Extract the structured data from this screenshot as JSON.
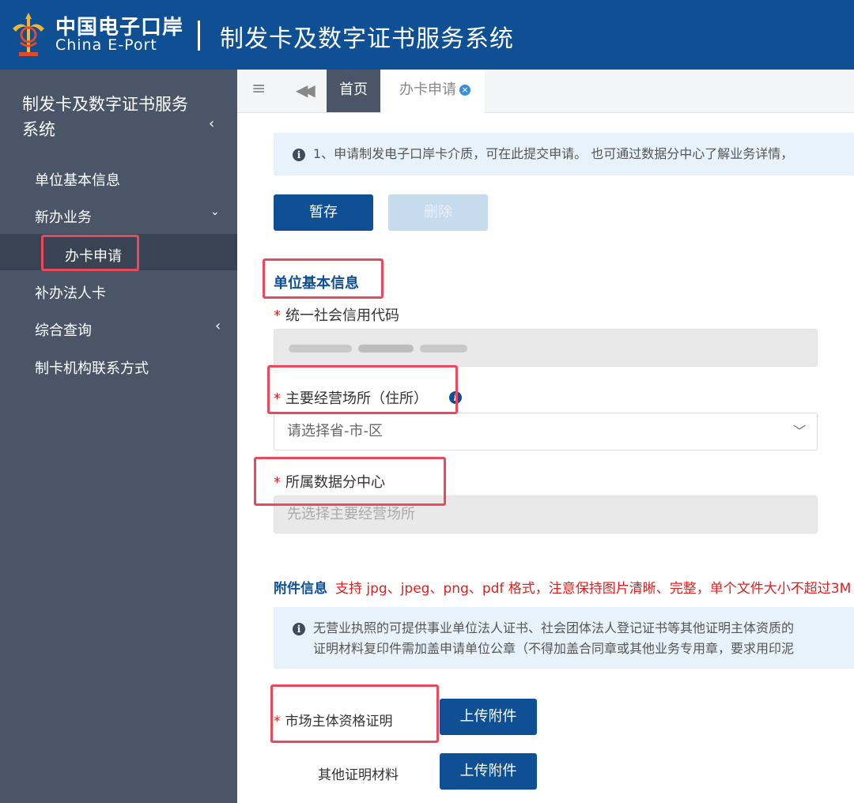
{
  "header": {
    "logo_cn": "中国电子口岸",
    "logo_en": "China E-Port",
    "system_title": "制发卡及数字证书服务系统"
  },
  "sidebar": {
    "title": "制发卡及数字证书服务系统",
    "items": [
      {
        "label": "单位基本信息"
      },
      {
        "label": "新办业务",
        "expanded": true,
        "children": [
          {
            "label": "办卡申请",
            "active": true
          }
        ]
      },
      {
        "label": "补办法人卡"
      },
      {
        "label": "综合查询"
      },
      {
        "label": "制卡机构联系方式"
      }
    ],
    "icons": {
      "collapse": "chevron-left-icon",
      "expand": "chevron-down-icon"
    }
  },
  "tabs": {
    "icons": {
      "menu": "hamburger-icon",
      "back": "double-left-arrow-icon",
      "close": "close-circle-icon"
    },
    "items": [
      {
        "label": "首页"
      },
      {
        "label": "办卡申请",
        "active": true
      }
    ]
  },
  "main": {
    "notice": "1、申请制发电子口岸卡介质，可在此提交申请。 也可通过数据分中心了解业务详情，",
    "toolbar": {
      "save_label": "暂存",
      "delete_label": "删除"
    },
    "section_title": "单位基本信息",
    "fields": {
      "credit_code": {
        "label": "统一社会信用代码",
        "required": true
      },
      "address": {
        "label": "主要经营场所（住所）",
        "required": true,
        "placeholder": "请选择省-市-区"
      },
      "data_center": {
        "label": "所属数据分中心",
        "required": true,
        "placeholder": "先选择主要经营场所"
      }
    },
    "attachments": {
      "title": "附件信息",
      "hint": "支持 jpg、jpeg、png、pdf 格式，注意保持图片清晰、完整，单个文件大小不超过3M",
      "notice_line1": "无营业执照的可提供事业单位法人证书、社会团体法人登记证书等其他证明主体资质的",
      "notice_line2": "证明材料复印件需加盖申请单位公章（不得加盖合同章或其他业务专用章，要求用印泥",
      "items": [
        {
          "label": "市场主体资格证明",
          "required": true,
          "button": "上传附件"
        },
        {
          "label": "其他证明材料",
          "required": false,
          "button": "上传附件"
        }
      ]
    }
  },
  "colors": {
    "brand": "#0f4f93",
    "sidebar": "#4a5568",
    "annotation": "#e8495c",
    "required": "#e02020"
  }
}
